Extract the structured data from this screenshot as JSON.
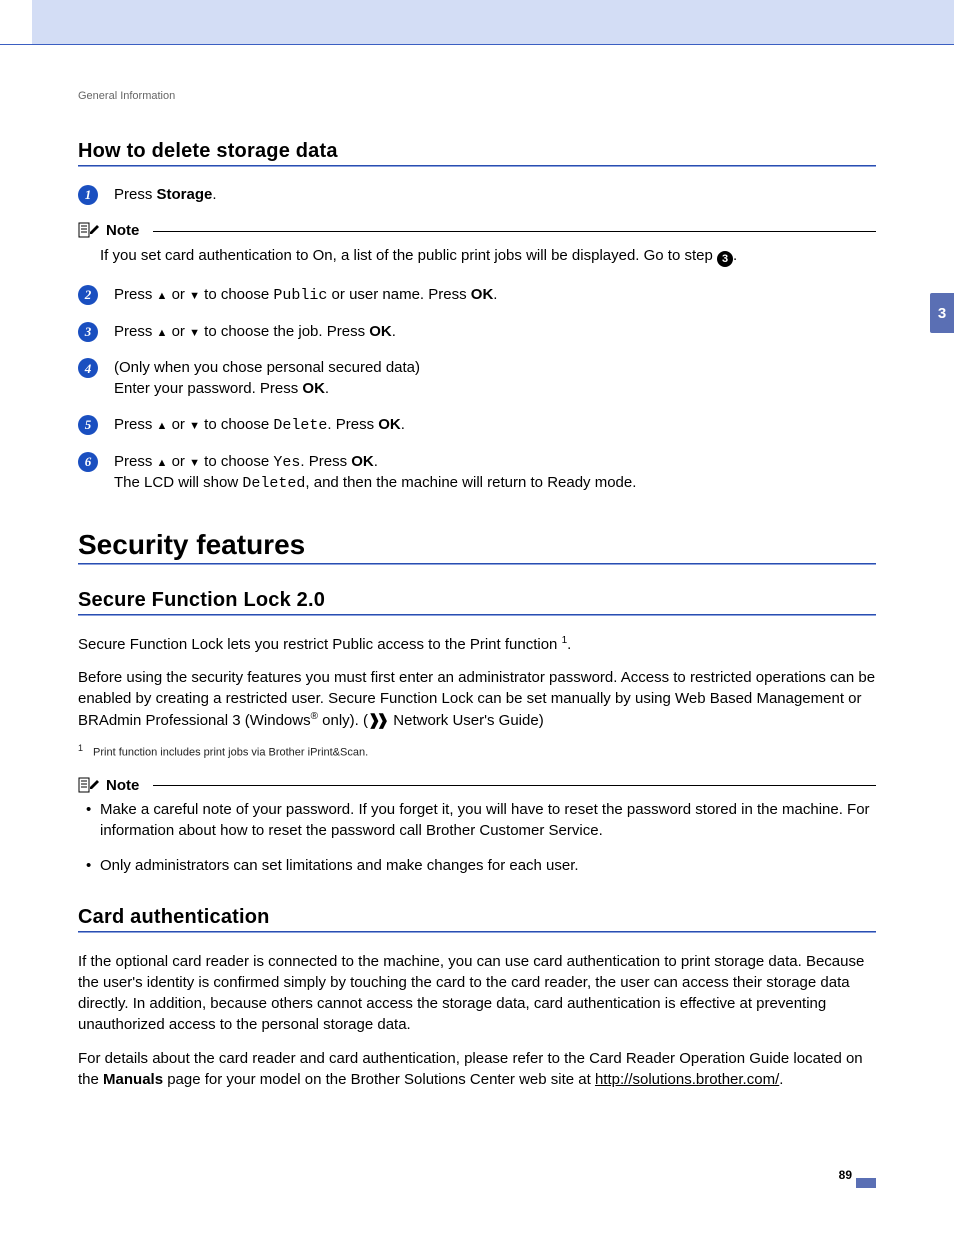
{
  "running_head": "General Information",
  "chapter_tab": "3",
  "page_number": "89",
  "h_delete": "How to delete storage data",
  "steps": {
    "s1_a": "Press ",
    "s1_b": "Storage",
    "s1_c": ".",
    "s2_a": "Press ",
    "s2_b": " or ",
    "s2_c": " to choose ",
    "s2_public": "Public",
    "s2_d": " or user name. Press ",
    "s2_ok": "OK",
    "s2_e": ".",
    "s3_a": "Press ",
    "s3_b": " or ",
    "s3_c": " to choose the job. Press ",
    "s3_ok": "OK",
    "s3_d": ".",
    "s4_a": "(Only when you chose personal secured data)",
    "s4_b": "Enter your password. Press ",
    "s4_ok": "OK",
    "s4_c": ".",
    "s5_a": "Press ",
    "s5_b": " or ",
    "s5_c": " to choose ",
    "s5_del": "Delete",
    "s5_d": ". Press ",
    "s5_ok": "OK",
    "s5_e": ".",
    "s6_a": "Press ",
    "s6_b": " or ",
    "s6_c": " to choose ",
    "s6_yes": "Yes",
    "s6_d": ". Press ",
    "s6_ok": "OK",
    "s6_e": ".",
    "s6_f": "The LCD will show ",
    "s6_deleted": "Deleted",
    "s6_g": ", and then the machine will return to Ready mode."
  },
  "note1": {
    "label": "Note",
    "body_a": "If you set card authentication to On, a list of the public print jobs will be displayed. Go to step ",
    "body_ref": "3",
    "body_b": "."
  },
  "h_security": "Security features",
  "h_sfl": "Secure Function Lock 2.0",
  "sfl_p1_a": "Secure Function Lock lets you restrict Public access to the Print function ",
  "sfl_p1_fn": "1",
  "sfl_p1_b": ".",
  "sfl_p2_a": "Before using the security features you must first enter an administrator password. Access to restricted operations can be enabled by creating a restricted user. Secure Function Lock can be set manually by using Web Based Management or BRAdmin Professional 3 (Windows",
  "sfl_p2_r": "®",
  "sfl_p2_b": " only). (",
  "sfl_p2_ref": " Network User's Guide)",
  "footnote1": "Print function includes print jobs via Brother iPrint&Scan.",
  "note2": {
    "label": "Note",
    "b1": "Make a careful note of your password. If you forget it, you will have to reset the password stored in the machine. For information about how to reset the password call Brother Customer Service.",
    "b2": "Only administrators can set limitations and make changes for each user."
  },
  "h_card": "Card authentication",
  "card_p1": "If the optional card reader is connected to the machine, you can use card authentication to print storage data. Because the user's identity is confirmed simply by touching the card to the card reader, the user can access their storage data directly. In addition, because others cannot access the storage data, card authentication is effective at preventing unauthorized access to the personal storage data.",
  "card_p2_a": "For details about the card reader and card authentication, please refer to the Card Reader Operation Guide located on the ",
  "card_p2_b": "Manuals",
  "card_p2_c": " page for your model on the Brother Solutions Center web site at ",
  "card_link": "http://solutions.brother.com/",
  "card_p2_d": "."
}
